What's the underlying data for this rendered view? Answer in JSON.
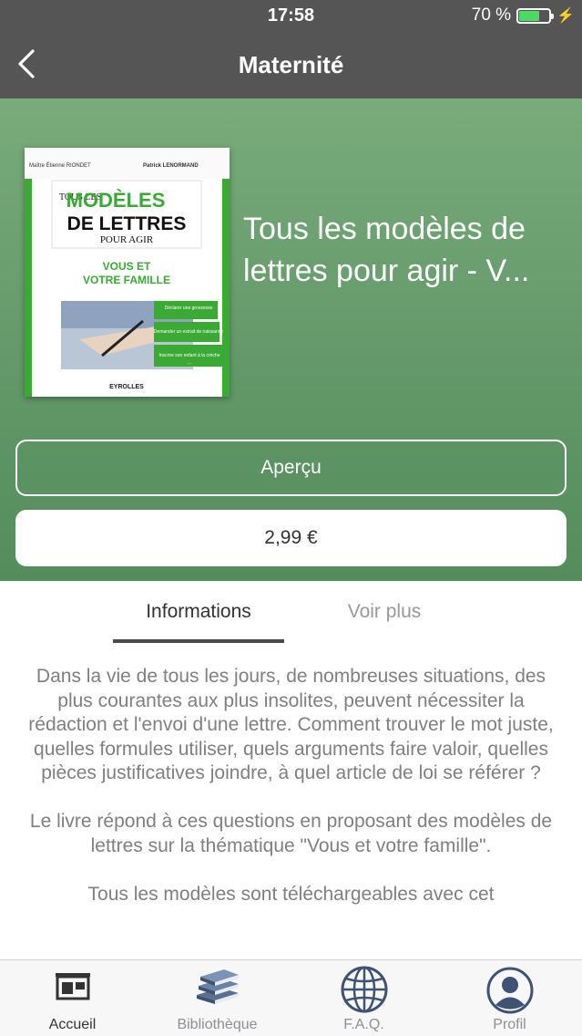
{
  "status_bar": {
    "time": "17:58",
    "battery_text": "70 %",
    "battery_level": 0.7,
    "charging_icon": "bolt-icon"
  },
  "nav": {
    "title": "Maternité",
    "back_icon": "chevron-left-icon"
  },
  "book": {
    "title": "Tous les modèles de lettres pour agir - V...",
    "cover": {
      "author_left": "Maître Étienne RIONDET",
      "author_right": "Patrick LENORMAND",
      "tous_les": "TOUS LES",
      "modeles": "MODÈLES",
      "de_lettres": "DE LETTRES",
      "pour_agir": "POUR AGIR",
      "subtitle_line1": "VOUS ET",
      "subtitle_line2": "VOTRE FAMILLE",
      "tag1": "Déclarer une grossesse",
      "tag2": "Demander un extrait de naissance",
      "tag3": "Inscrire son enfant à la crèche",
      "tag4": "...",
      "publisher": "EYROLLES",
      "accent_color": "#3aaa35"
    }
  },
  "actions": {
    "preview_label": "Aperçu",
    "price_label": "2,99 €"
  },
  "tabs": {
    "info_label": "Informations",
    "more_label": "Voir plus"
  },
  "description": [
    "Dans la vie de tous les jours, de nombreuses situations, des plus courantes aux plus insolites, peuvent nécessiter la rédaction et l'envoi d'une lettre. Comment trouver le mot juste, quelles formules utiliser, quels arguments faire valoir, quelles pièces justificatives joindre, à quel article de loi se référer ?",
    "Le livre répond à ces questions en proposant des modèles de lettres sur la thématique \"Vous et votre famille\".",
    "Tous les modèles sont téléchargeables avec cet"
  ],
  "tab_bar": {
    "items": [
      {
        "label": "Accueil",
        "icon": "store-icon",
        "active": true
      },
      {
        "label": "Bibliothèque",
        "icon": "books-icon",
        "active": false
      },
      {
        "label": "F.A.Q.",
        "icon": "globe-icon",
        "active": false
      },
      {
        "label": "Profil",
        "icon": "user-icon",
        "active": false
      }
    ]
  },
  "colors": {
    "header": "#555555",
    "hero_green": "#64986a",
    "book_green": "#3aaa35",
    "text_gray": "#808080"
  }
}
